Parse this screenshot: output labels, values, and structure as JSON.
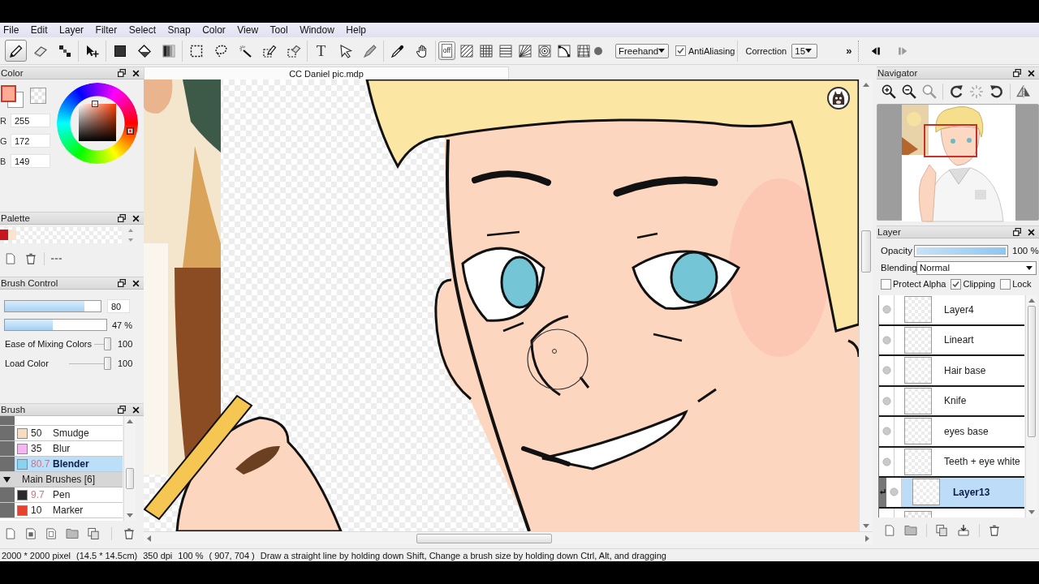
{
  "menu": [
    "File",
    "Edit",
    "Layer",
    "Filter",
    "Select",
    "Snap",
    "Color",
    "View",
    "Tool",
    "Window",
    "Help"
  ],
  "toolbar": {
    "tool_groups": [
      [
        {
          "kind": "pen",
          "selected": true
        },
        {
          "kind": "eraser",
          "selected": false
        },
        {
          "kind": "dot",
          "selected": false
        }
      ],
      [
        {
          "kind": "move",
          "selected": false
        }
      ],
      [
        {
          "kind": "fill",
          "selected": false
        },
        {
          "kind": "bucket",
          "selected": false
        },
        {
          "kind": "gradient",
          "selected": false
        }
      ],
      [
        {
          "kind": "select",
          "selected": false
        },
        {
          "kind": "lasso",
          "selected": false
        },
        {
          "kind": "magic_wand",
          "selected": false
        },
        {
          "kind": "select_pen",
          "selected": false
        },
        {
          "kind": "select_eraser",
          "selected": false
        }
      ],
      [
        {
          "kind": "text",
          "label": "T",
          "selected": false
        },
        {
          "kind": "operation",
          "selected": false
        },
        {
          "kind": "blur",
          "selected": false
        }
      ],
      [
        {
          "kind": "eyedropper",
          "selected": false
        },
        {
          "kind": "hand",
          "selected": false
        }
      ]
    ],
    "snap_modes": [
      {
        "kind": "off",
        "label": "off",
        "selected": true
      },
      {
        "kind": "parallel",
        "selected": false
      },
      {
        "kind": "grid",
        "selected": false
      },
      {
        "kind": "lines",
        "selected": false
      },
      {
        "kind": "radial",
        "selected": false
      },
      {
        "kind": "concentric",
        "selected": false
      },
      {
        "kind": "curve",
        "selected": false
      },
      {
        "kind": "perspective",
        "selected": false
      }
    ],
    "stroke_mode": "Freehand",
    "antialiasing": {
      "label": "AntiAliasing",
      "checked": true
    },
    "correction": {
      "label": "Correction",
      "value": "15"
    },
    "more": "»"
  },
  "color": {
    "title": "Color",
    "swatches": [
      {
        "kind": "foreground",
        "color": "#ffac95"
      },
      {
        "kind": "background",
        "color": "#ffffff"
      }
    ],
    "channels": [
      {
        "label": "R",
        "value": "255"
      },
      {
        "label": "G",
        "value": "172"
      },
      {
        "label": "B",
        "value": "149"
      }
    ]
  },
  "palette": {
    "title": "Palette",
    "colors": [
      {
        "color": "#c8141e"
      },
      {
        "color": "#fde2d0"
      }
    ]
  },
  "brush_control": {
    "title": "Brush Control",
    "size": {
      "level": 0.83,
      "value": "80"
    },
    "opacity": {
      "level": 0.47,
      "reading": "47 %"
    },
    "sliders": [
      {
        "label": "Ease of Mixing Colors",
        "level": 1,
        "value": "100"
      },
      {
        "label": "Load Color",
        "level": 1,
        "value": "100"
      }
    ]
  },
  "brush": {
    "title": "Brush",
    "items": [
      {
        "kind": "brush",
        "color": "#f7dcc0",
        "size": "50",
        "size_highlighted": false,
        "name": "Smudge",
        "selected": false
      },
      {
        "kind": "brush",
        "color": "#f2b8ef",
        "size": "35",
        "size_highlighted": false,
        "name": "Blur",
        "selected": false
      },
      {
        "kind": "brush",
        "color": "#86d3f3",
        "size": "80.7",
        "size_highlighted": true,
        "name": "Blender",
        "selected": true
      },
      {
        "kind": "group",
        "name": "Main Brushes [6]",
        "expanded": true,
        "children": [
          {
            "kind": "brush",
            "color": "#2a2a2a",
            "size": "9.7",
            "size_highlighted": true,
            "name": "Pen",
            "selected": false
          },
          {
            "kind": "brush",
            "color": "#e8412e",
            "size": "10",
            "size_highlighted": false,
            "name": "Marker",
            "selected": false
          }
        ]
      }
    ]
  },
  "canvas": {
    "tab": "CC Daniel pic.mdp"
  },
  "navigator": {
    "title": "Navigator"
  },
  "layer": {
    "title": "Layer",
    "opacity": {
      "label": "Opacity",
      "level": 1,
      "reading": "100 %"
    },
    "blending": {
      "label": "Blending",
      "value": "Normal"
    },
    "options": [
      {
        "label": "Protect Alpha",
        "checked": false
      },
      {
        "label": "Clipping",
        "checked": true
      },
      {
        "label": "Lock",
        "checked": false
      }
    ],
    "layers": [
      {
        "name": "Layer4",
        "selected": false,
        "clipping": false
      },
      {
        "name": "Lineart",
        "selected": false,
        "clipping": false
      },
      {
        "name": "Hair base",
        "selected": false,
        "clipping": false
      },
      {
        "name": "Knife",
        "selected": false,
        "clipping": false
      },
      {
        "name": "eyes base",
        "selected": false,
        "clipping": false
      },
      {
        "name": "Teeth + eye white",
        "selected": false,
        "clipping": false
      },
      {
        "name": "Layer13",
        "selected": true,
        "clipping": true
      }
    ]
  },
  "status_bar": [
    "2000 * 2000 pixel",
    "(14.5 * 14.5cm)",
    "350 dpi",
    "100 %",
    "( 907, 704 )",
    "Draw a straight line by holding down Shift, Change a brush size by holding down Ctrl, Alt, and dragging"
  ]
}
